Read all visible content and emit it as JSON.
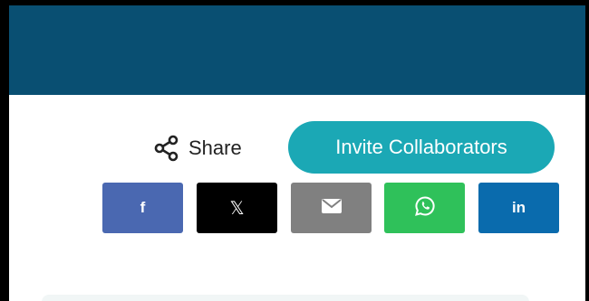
{
  "header": {
    "color": "#094f72"
  },
  "share": {
    "label": "Share",
    "icon": "share-icon"
  },
  "invite": {
    "label": "Invite Collaborators",
    "color": "#1ba8b5"
  },
  "social_buttons": [
    {
      "name": "facebook",
      "glyph": "f",
      "icon": "facebook-icon",
      "color": "#4a68b1"
    },
    {
      "name": "x",
      "glyph": "𝕏",
      "icon": "x-icon",
      "color": "#000000"
    },
    {
      "name": "email",
      "icon": "email-icon",
      "color": "#808080"
    },
    {
      "name": "whatsapp",
      "icon": "whatsapp-icon",
      "color": "#2fc15a"
    },
    {
      "name": "linkedin",
      "glyph": "in",
      "icon": "linkedin-icon",
      "color": "#0a6bad"
    }
  ]
}
